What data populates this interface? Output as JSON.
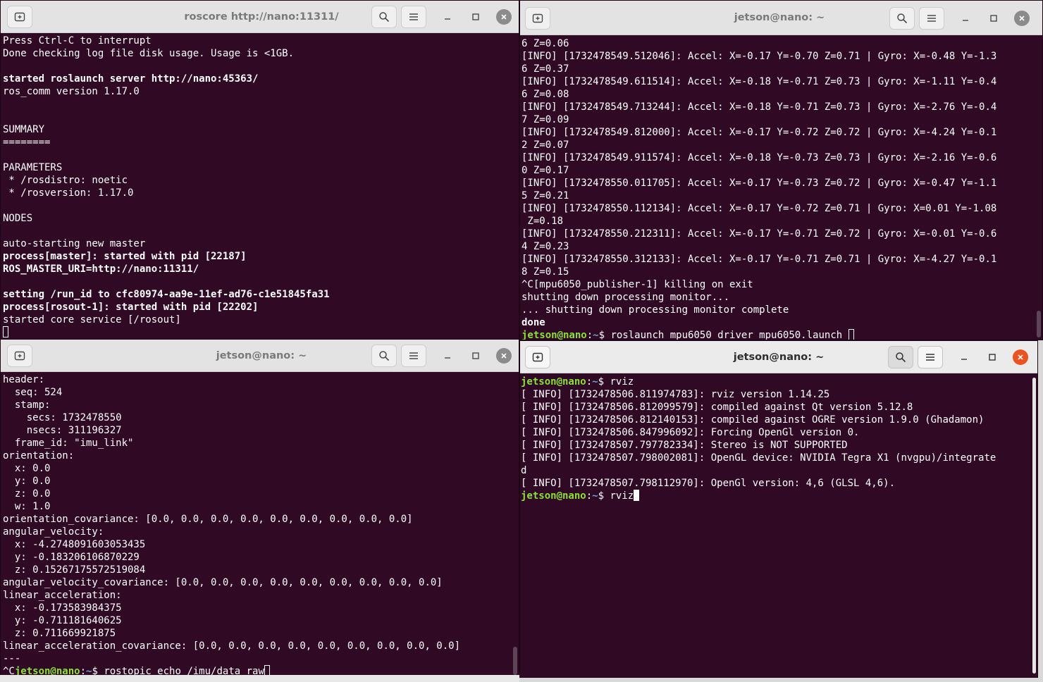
{
  "colors": {
    "terminal_bg": "#300a24",
    "prompt_user": "#8ae234",
    "prompt_path": "#729fcf",
    "close_active": "#e95420"
  },
  "icons": {
    "new_tab": "new-tab-icon",
    "search": "search-icon",
    "menu": "hamburger-menu-icon",
    "minimize": "minimize-icon",
    "maximize": "maximize-icon",
    "close": "close-icon"
  },
  "windows": {
    "top_left": {
      "title": "roscore http://nano:11311/",
      "lines": [
        {
          "t": "Press Ctrl-C to interrupt"
        },
        {
          "t": "Done checking log file disk usage. Usage is <1GB."
        },
        {
          "t": ""
        },
        {
          "t": "started roslaunch server http://nano:45363/",
          "bold": true
        },
        {
          "t": "ros_comm version 1.17.0"
        },
        {
          "t": ""
        },
        {
          "t": ""
        },
        {
          "t": "SUMMARY"
        },
        {
          "t": "========"
        },
        {
          "t": ""
        },
        {
          "t": "PARAMETERS"
        },
        {
          "t": " * /rosdistro: noetic"
        },
        {
          "t": " * /rosversion: 1.17.0"
        },
        {
          "t": ""
        },
        {
          "t": "NODES"
        },
        {
          "t": ""
        },
        {
          "t": "auto-starting new master"
        },
        {
          "t": "process[master]: started with pid [22187]",
          "bold": true
        },
        {
          "t": "ROS_MASTER_URI=http://nano:11311/",
          "bold": true
        },
        {
          "t": ""
        },
        {
          "t": "setting /run_id to cfc80974-aa9e-11ef-ad76-c1e51845fa31",
          "bold": true
        },
        {
          "t": "process[rosout-1]: started with pid [22202]",
          "bold": true
        },
        {
          "t": "started core service [/rosout]"
        }
      ]
    },
    "top_right": {
      "title": "jetson@nano: ~",
      "lines": [
        {
          "t": "6 Z=0.06"
        },
        {
          "t": "[INFO] [1732478549.512046]: Accel: X=-0.17 Y=-0.70 Z=0.71 | Gyro: X=-0.48 Y=-1.3"
        },
        {
          "t": "6 Z=0.37"
        },
        {
          "t": "[INFO] [1732478549.611514]: Accel: X=-0.18 Y=-0.71 Z=0.73 | Gyro: X=-1.11 Y=-0.4"
        },
        {
          "t": "6 Z=0.08"
        },
        {
          "t": "[INFO] [1732478549.713244]: Accel: X=-0.18 Y=-0.71 Z=0.73 | Gyro: X=-2.76 Y=-0.4"
        },
        {
          "t": "7 Z=0.09"
        },
        {
          "t": "[INFO] [1732478549.812000]: Accel: X=-0.17 Y=-0.72 Z=0.72 | Gyro: X=-4.24 Y=-0.1"
        },
        {
          "t": "2 Z=0.07"
        },
        {
          "t": "[INFO] [1732478549.911574]: Accel: X=-0.18 Y=-0.73 Z=0.73 | Gyro: X=-2.16 Y=-0.6"
        },
        {
          "t": "0 Z=0.17"
        },
        {
          "t": "[INFO] [1732478550.011705]: Accel: X=-0.17 Y=-0.73 Z=0.72 | Gyro: X=-0.47 Y=-1.1"
        },
        {
          "t": "5 Z=0.21"
        },
        {
          "t": "[INFO] [1732478550.112134]: Accel: X=-0.17 Y=-0.72 Z=0.71 | Gyro: X=0.01 Y=-1.08"
        },
        {
          "t": " Z=0.18"
        },
        {
          "t": "[INFO] [1732478550.212311]: Accel: X=-0.17 Y=-0.71 Z=0.72 | Gyro: X=-0.01 Y=-0.6"
        },
        {
          "t": "4 Z=0.23"
        },
        {
          "t": "[INFO] [1732478550.312133]: Accel: X=-0.17 Y=-0.71 Z=0.71 | Gyro: X=-4.27 Y=-0.1"
        },
        {
          "t": "8 Z=0.15"
        },
        {
          "t": "^C[mpu6050_publisher-1] killing on exit"
        },
        {
          "t": "shutting down processing monitor..."
        },
        {
          "t": "... shutting down processing monitor complete"
        },
        {
          "t": "done",
          "bold": true
        }
      ],
      "prompt": {
        "prefix": "",
        "user": "jetson@nano",
        "path": "~",
        "cmd": "roslaunch mpu6050_driver mpu6050.launch "
      }
    },
    "bottom_left": {
      "title": "jetson@nano: ~",
      "lines": [
        {
          "t": "header:"
        },
        {
          "t": "  seq: 524"
        },
        {
          "t": "  stamp:"
        },
        {
          "t": "    secs: 1732478550"
        },
        {
          "t": "    nsecs: 311196327"
        },
        {
          "t": "  frame_id: \"imu_link\""
        },
        {
          "t": "orientation:"
        },
        {
          "t": "  x: 0.0"
        },
        {
          "t": "  y: 0.0"
        },
        {
          "t": "  z: 0.0"
        },
        {
          "t": "  w: 1.0"
        },
        {
          "t": "orientation_covariance: [0.0, 0.0, 0.0, 0.0, 0.0, 0.0, 0.0, 0.0, 0.0]"
        },
        {
          "t": "angular_velocity:"
        },
        {
          "t": "  x: -4.2748091603053435"
        },
        {
          "t": "  y: -0.183206106870229"
        },
        {
          "t": "  z: 0.15267175572519084"
        },
        {
          "t": "angular_velocity_covariance: [0.0, 0.0, 0.0, 0.0, 0.0, 0.0, 0.0, 0.0, 0.0]"
        },
        {
          "t": "linear_acceleration:"
        },
        {
          "t": "  x: -0.173583984375"
        },
        {
          "t": "  y: -0.711181640625"
        },
        {
          "t": "  z: 0.711669921875"
        },
        {
          "t": "linear_acceleration_covariance: [0.0, 0.0, 0.0, 0.0, 0.0, 0.0, 0.0, 0.0, 0.0]"
        },
        {
          "t": "---"
        }
      ],
      "prompt": {
        "prefix": "^C",
        "user": "jetson@nano",
        "path": "~",
        "cmd": "rostopic echo /imu/data_raw"
      }
    },
    "bottom_right": {
      "title": "jetson@nano: ~",
      "lines": [
        {
          "prompt": {
            "prefix": "",
            "user": "jetson@nano",
            "path": "~",
            "cmd": "rviz"
          }
        },
        {
          "t": "[ INFO] [1732478506.811974783]: rviz version 1.14.25"
        },
        {
          "t": "[ INFO] [1732478506.812099579]: compiled against Qt version 5.12.8"
        },
        {
          "t": "[ INFO] [1732478506.812140153]: compiled against OGRE version 1.9.0 (Ghadamon)"
        },
        {
          "t": "[ INFO] [1732478506.847996092]: Forcing OpenGl version 0."
        },
        {
          "t": "[ INFO] [1732478507.797782334]: Stereo is NOT SUPPORTED"
        },
        {
          "t": "[ INFO] [1732478507.798002081]: OpenGL device: NVIDIA Tegra X1 (nvgpu)/integrate"
        },
        {
          "t": "d"
        },
        {
          "t": "[ INFO] [1732478507.798112970]: OpenGl version: 4,6 (GLSL 4,6)."
        }
      ],
      "prompt": {
        "prefix": "",
        "user": "jetson@nano",
        "path": "~",
        "cmd": "rviz"
      }
    }
  }
}
